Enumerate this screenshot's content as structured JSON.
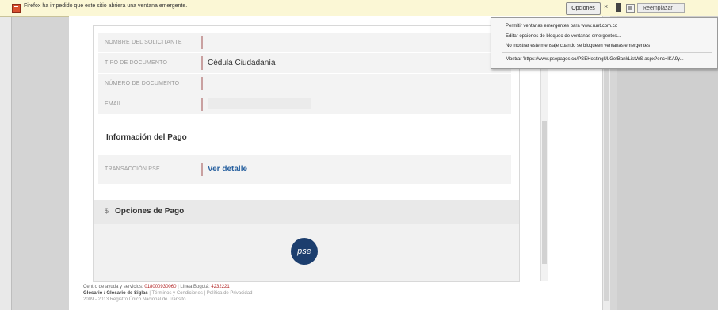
{
  "popup_bar": {
    "message": "Firefox ha impedido que este sitio abriera una ventana emergente.",
    "options_label": "Opciones",
    "close_label": "×",
    "replace_label": "Reemplazar"
  },
  "popup_menu": {
    "items": [
      "Permitir ventanas emergentes para www.runt.com.co",
      "Editar opciones de bloqueo de ventanas emergentes...",
      "No mostrar este mensaje cuando se bloqueen ventanas emergentes",
      "Mostrar 'https://www.psepagos.co/PSEHostingUI/GetBankListWS.aspx?enc=lKA9y..."
    ]
  },
  "applicant": {
    "rows": [
      {
        "label": "NOMBRE DEL SOLICITANTE",
        "value": ""
      },
      {
        "label": "TIPO DE DOCUMENTO",
        "value": "Cédula Ciudadanía"
      },
      {
        "label": "NÚMERO DE DOCUMENTO",
        "value": ""
      },
      {
        "label": "EMAIL",
        "value": ""
      }
    ]
  },
  "payment_info": {
    "title": "Información del Pago",
    "row_label": "TRANSACCIÓN PSE",
    "row_link": "Ver detalle"
  },
  "payment_options": {
    "symbol": "$",
    "title": "Opciones de Pago",
    "logo_text": "pse"
  },
  "footer": {
    "line1_prefix": "Centro de ayuda y servicios: ",
    "line1_phone1": "018000930060",
    "line1_mid": " | Línea Bogotá: ",
    "line1_phone2": "4232221",
    "line2_strong": "Glosario / Glosario de Siglas",
    "line2_rest": " | Términos y Condiciones | Política de Privacidad",
    "line3": "2009 - 2013 Registro Único Nacional de Tránsito"
  },
  "colors": {
    "notification_bg": "#fbf7d5",
    "link": "#2a62a0",
    "pse_logo": "#1c3e6e"
  }
}
